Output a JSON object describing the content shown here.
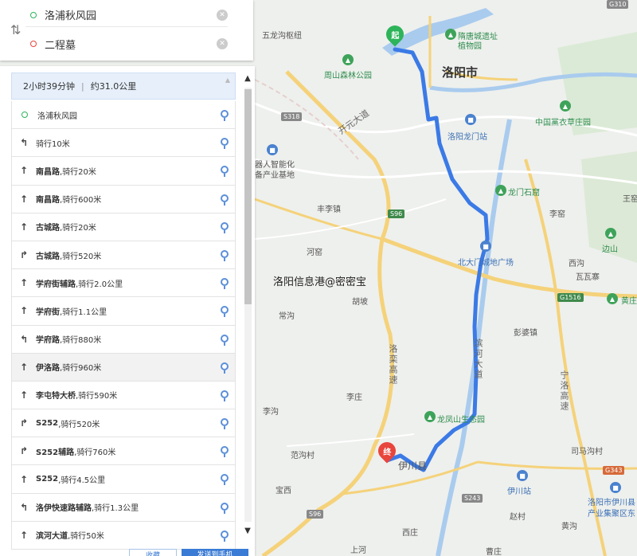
{
  "search": {
    "origin": "洛浦秋风园",
    "destination": "二程墓"
  },
  "summary": {
    "duration": "2小时39分钟",
    "distance": "约31.0公里"
  },
  "steps": [
    {
      "type": "origin",
      "road": "",
      "text": "洛浦秋风园"
    },
    {
      "type": "turn-left",
      "road": "",
      "text": "骑行10米"
    },
    {
      "type": "straight",
      "road": "南昌路",
      "text": ",骑行20米"
    },
    {
      "type": "straight",
      "road": "南昌路",
      "text": ",骑行600米"
    },
    {
      "type": "straight",
      "road": "古城路",
      "text": ",骑行20米"
    },
    {
      "type": "turn-right",
      "road": "古城路",
      "text": ",骑行520米"
    },
    {
      "type": "straight",
      "road": "学府街辅路",
      "text": ",骑行2.0公里"
    },
    {
      "type": "straight",
      "road": "学府街",
      "text": ",骑行1.1公里"
    },
    {
      "type": "keep-left",
      "road": "学府路",
      "text": ",骑行880米"
    },
    {
      "type": "straight",
      "road": "伊洛路",
      "text": ",骑行960米"
    },
    {
      "type": "straight",
      "road": "李屯特大桥",
      "text": ",骑行590米"
    },
    {
      "type": "bear-right",
      "road": "S252",
      "text": ",骑行520米"
    },
    {
      "type": "bear-right",
      "road": "S252辅路",
      "text": ",骑行760米"
    },
    {
      "type": "straight",
      "road": "S252",
      "text": ",骑行4.5公里"
    },
    {
      "type": "turn-left",
      "road": "洛伊快速路辅路",
      "text": ",骑行1.3公里"
    },
    {
      "type": "straight",
      "road": "滨河大道",
      "text": ",骑行50米"
    }
  ],
  "bottom": {
    "collect_label": "收藏",
    "send_label": "发送到手机"
  },
  "map": {
    "labels": {
      "wulong": "五龙沟枢纽",
      "suitang": "隋唐城遗址",
      "zhiwuyuan": "植物园",
      "zhoushan": "周山森林公园",
      "luoyang": "洛阳市",
      "kaiyuan": "开元大道",
      "zhongguo": "中国黨衣草庄园",
      "longmen_station": "洛阳龙门站",
      "jiqiren": "器人智能化",
      "chanye": "备产业基地",
      "fengli": "丰李镇",
      "longmen_cave": "龙门石窟",
      "liwo": "李窑",
      "wangzhai": "王窑",
      "heyan": "河窑",
      "beidamen": "北大门城地广场",
      "bianshan": "边山",
      "xigou": "西沟",
      "wawanzhai": "瓦瓦寨",
      "huangzhuang": "黄庄",
      "watermark": "洛阳信息港@密密宝",
      "hupo": "胡坡",
      "changgou": "常沟",
      "pengpo": "彭婆镇",
      "luoluan": "洛栾高速",
      "binhe": "滨河大道",
      "ningluo": "宁洛高速",
      "lizhuang": "李庄",
      "ligou": "李沟",
      "longfengshan": "龙凤山生态园",
      "fangou": "范沟村",
      "yichuan": "伊川县",
      "simagou": "司马沟村",
      "yichuan_station": "伊川站",
      "chanye2": "洛阳市伊川县",
      "chanye3": "产业集聚区东",
      "baoxi": "宝西",
      "zhaocun": "赵村",
      "huangdong": "黄沟",
      "xiazhuang": "西庄",
      "caozhuang": "曹庄",
      "shanghe": "上河"
    },
    "shields": {
      "s318": "S318",
      "s96a": "S96",
      "g1516": "G1516",
      "s96b": "S96",
      "s243": "S243",
      "g343": "G343",
      "top_right": "G310"
    }
  }
}
